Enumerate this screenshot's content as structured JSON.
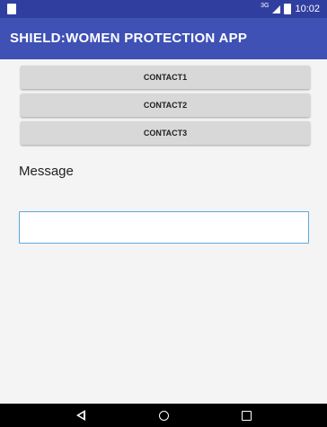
{
  "status_bar": {
    "network": "3G",
    "time": "10:02",
    "icons": [
      "notification-icon",
      "signal-icon",
      "battery-icon"
    ]
  },
  "app_bar": {
    "title": "SHIELD:WOMEN PROTECTION APP"
  },
  "contacts": {
    "button1": "CONTACT1",
    "button2": "CONTACT2",
    "button3": "CONTACT3"
  },
  "message": {
    "label": "Message",
    "value": "",
    "placeholder": ""
  },
  "nav": {
    "icons": [
      "back-icon",
      "home-icon",
      "recents-icon"
    ]
  },
  "colors": {
    "status_bar": "#303F9F",
    "app_bar": "#3F51B5",
    "button_bg": "#d8d8d8",
    "input_border": "#5aa9dd",
    "nav_bar": "#000000"
  }
}
